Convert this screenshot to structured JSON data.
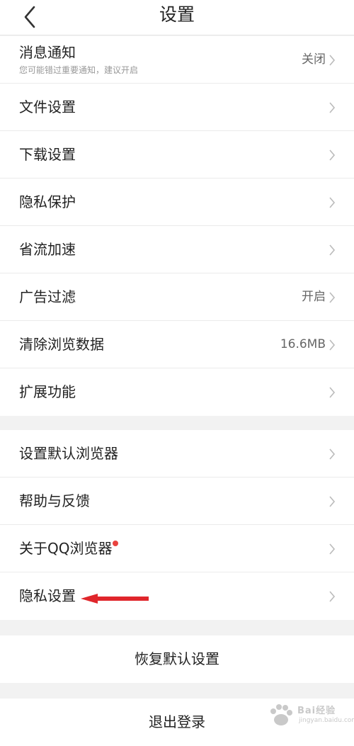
{
  "header": {
    "title": "设置"
  },
  "group1": [
    {
      "label": "消息通知",
      "sub": "您可能错过重要通知，建议开启",
      "value": "关闭"
    },
    {
      "label": "文件设置",
      "value": ""
    },
    {
      "label": "下载设置",
      "value": ""
    },
    {
      "label": "隐私保护",
      "value": ""
    },
    {
      "label": "省流加速",
      "value": ""
    },
    {
      "label": "广告过滤",
      "value": "开启"
    },
    {
      "label": "清除浏览数据",
      "value": "16.6MB"
    },
    {
      "label": "扩展功能",
      "value": ""
    }
  ],
  "group2": [
    {
      "label": "设置默认浏览器"
    },
    {
      "label": "帮助与反馈"
    },
    {
      "label": "关于QQ浏览器",
      "badge": true
    },
    {
      "label": "隐私设置",
      "annotated": true
    }
  ],
  "restore": {
    "label": "恢复默认设置"
  },
  "logout": {
    "label": "退出登录"
  },
  "watermark": {
    "text": "Bai经验",
    "sub": "jingyan.baidu.com"
  },
  "colors": {
    "badge": "#e9433f",
    "annotation_arrow": "#e0262b"
  }
}
